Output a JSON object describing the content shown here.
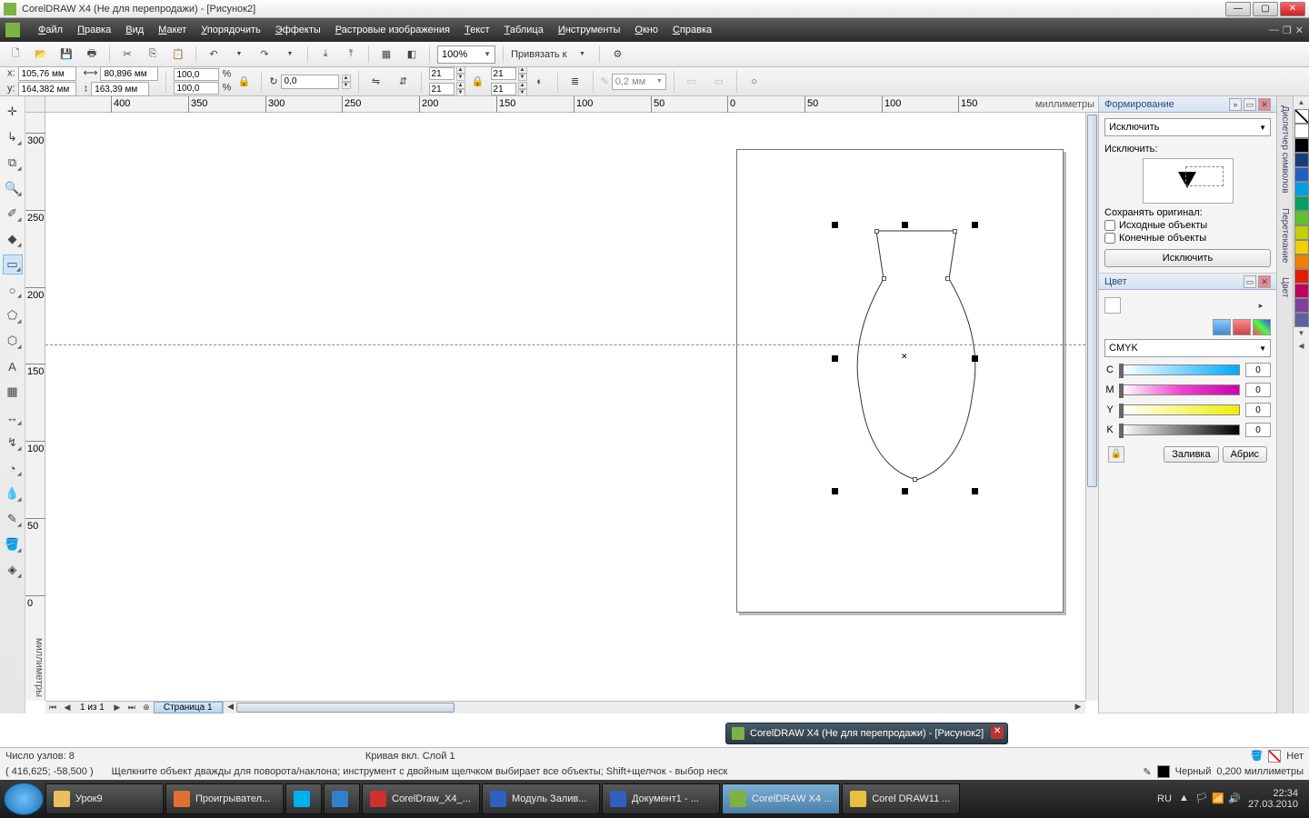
{
  "titlebar": {
    "text": "CorelDRAW X4 (Не для перепродажи) - [Рисунок2]"
  },
  "menu": [
    "Файл",
    "Правка",
    "Вид",
    "Макет",
    "Упорядочить",
    "Эффекты",
    "Растровые изображения",
    "Текст",
    "Таблица",
    "Инструменты",
    "Окно",
    "Справка"
  ],
  "toolbar": {
    "zoom": "100%",
    "snap_label": "Привязать к"
  },
  "propbar": {
    "x": "105,76 мм",
    "y": "164,382 мм",
    "w": "80,896 мм",
    "h": "163,39 мм",
    "sx": "100,0",
    "sy": "100,0",
    "rot": "0,0",
    "skew1": "21",
    "skew2": "21",
    "skew3": "21",
    "skew4": "21",
    "outline": "0,2 мм"
  },
  "ruler": {
    "h_ticks": [
      {
        "pos": 72,
        "label": "400"
      },
      {
        "pos": 157,
        "label": "350"
      },
      {
        "pos": 242,
        "label": "300"
      },
      {
        "pos": 326,
        "label": "250"
      },
      {
        "pos": 411,
        "label": "200"
      },
      {
        "pos": 496,
        "label": "150"
      },
      {
        "pos": 581,
        "label": "100"
      },
      {
        "pos": 666,
        "label": "50"
      },
      {
        "pos": 750,
        "label": "0"
      },
      {
        "pos": 835,
        "label": "50"
      },
      {
        "pos": 920,
        "label": "100"
      },
      {
        "pos": 1004,
        "label": "150"
      }
    ],
    "h_units": "миллиметры",
    "v_ticks": [
      {
        "pos": 22,
        "label": "300"
      },
      {
        "pos": 107,
        "label": "250"
      },
      {
        "pos": 192,
        "label": "200"
      },
      {
        "pos": 276,
        "label": "150"
      },
      {
        "pos": 361,
        "label": "100"
      },
      {
        "pos": 446,
        "label": "50"
      },
      {
        "pos": 531,
        "label": "0"
      }
    ],
    "v_units": "миллиметры"
  },
  "page_nav": {
    "info": "1 из 1",
    "tab": "Страница 1"
  },
  "dockers": {
    "shaping": {
      "title": "Формирование",
      "combo": "Исключить",
      "section_label": "Исключить:",
      "keep_label": "Сохранять оригинал:",
      "chk_source": "Исходные объекты",
      "chk_target": "Конечные объекты",
      "action": "Исключить"
    },
    "color": {
      "title": "Цвет",
      "model": "CMYK",
      "c": "0",
      "m": "0",
      "y": "0",
      "k": "0",
      "btn_fill": "Заливка",
      "btn_outline": "Абрис"
    },
    "side_tabs": [
      "Диспетчер символов",
      "Перетекание",
      "Цвет"
    ]
  },
  "palette": [
    "#ffffff",
    "#000000",
    "#1a3d7a",
    "#2060c0",
    "#00a0e0",
    "#00a060",
    "#60c030",
    "#c0d000",
    "#f0d000",
    "#f08000",
    "#e02000",
    "#c00060",
    "#8040a0",
    "#6060a0"
  ],
  "status": {
    "nodes": "Число узлов: 8",
    "layer": "Кривая вкл. Слой 1",
    "coords": "( 416,625; -58,500 )",
    "hint": "Щелкните объект дважды для поворота/наклона; инструмент с двойным щелчком выбирает все объекты; Shift+щелчок - выбор неск",
    "fill_label": "Нет",
    "outline_label": "Черный",
    "outline_width": "0,200 миллиметры"
  },
  "notify": {
    "text": "CorelDRAW X4 (Не для перепродажи) - [Рисунок2]"
  },
  "taskbar": {
    "items": [
      {
        "label": "Урок9",
        "color": "#e8c060"
      },
      {
        "label": "Проигрывател...",
        "color": "#e07030"
      },
      {
        "label": "",
        "color": "#00aff0"
      },
      {
        "label": "",
        "color": "#3080d0"
      },
      {
        "label": "CorelDraw_X4_...",
        "color": "#d03030"
      },
      {
        "label": "Модуль Залив...",
        "color": "#3060c0"
      },
      {
        "label": "Документ1 - ...",
        "color": "#3060c0"
      },
      {
        "label": "CorelDRAW X4 ...",
        "color": "#7cb342",
        "active": true
      },
      {
        "label": "Corel DRAW11 ...",
        "color": "#e8c040"
      }
    ],
    "lang": "RU",
    "time": "22:34",
    "date": "27.03.2010"
  }
}
